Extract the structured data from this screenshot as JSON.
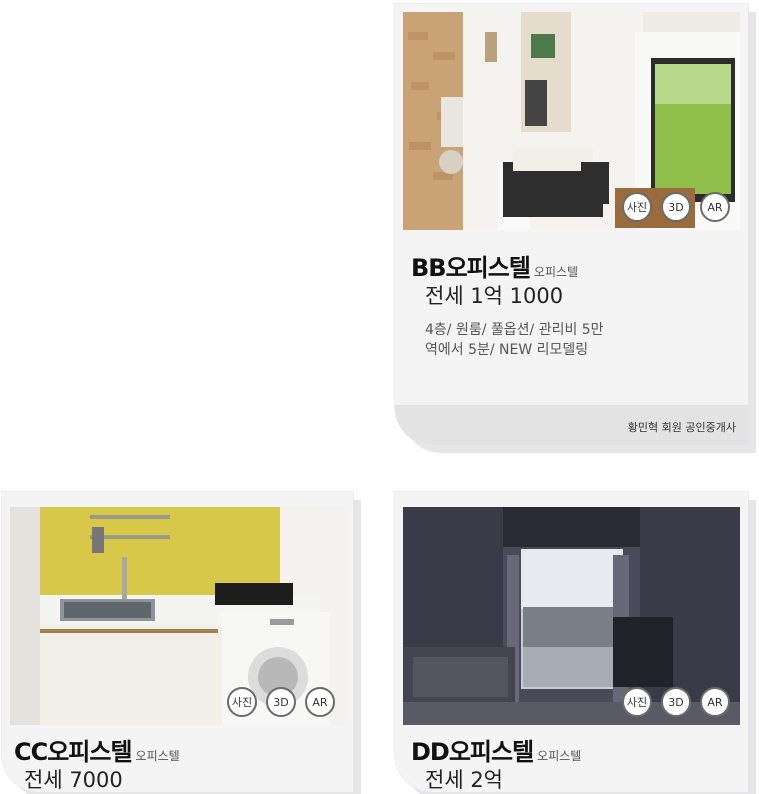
{
  "listings": [
    {
      "name": "BB오피스텔",
      "type": "오피스텔",
      "price": "전세 1억 1000",
      "desc1": "4층/ 원룸/ 풀옵션/ 관리비 5만",
      "desc2": "역에서 5분/ NEW 리모델링",
      "agent": "황민혁 회원 공인중개사",
      "badges": [
        "사진",
        "3D",
        "AR"
      ]
    },
    {
      "name": "CC오피스텔",
      "type": "오피스텔",
      "price": "전세 7000",
      "badges": [
        "사진",
        "3D",
        "AR"
      ]
    },
    {
      "name": "DD오피스텔",
      "type": "오피스텔",
      "price": "전세 2억",
      "badges": [
        "사진",
        "3D",
        "AR"
      ]
    }
  ]
}
